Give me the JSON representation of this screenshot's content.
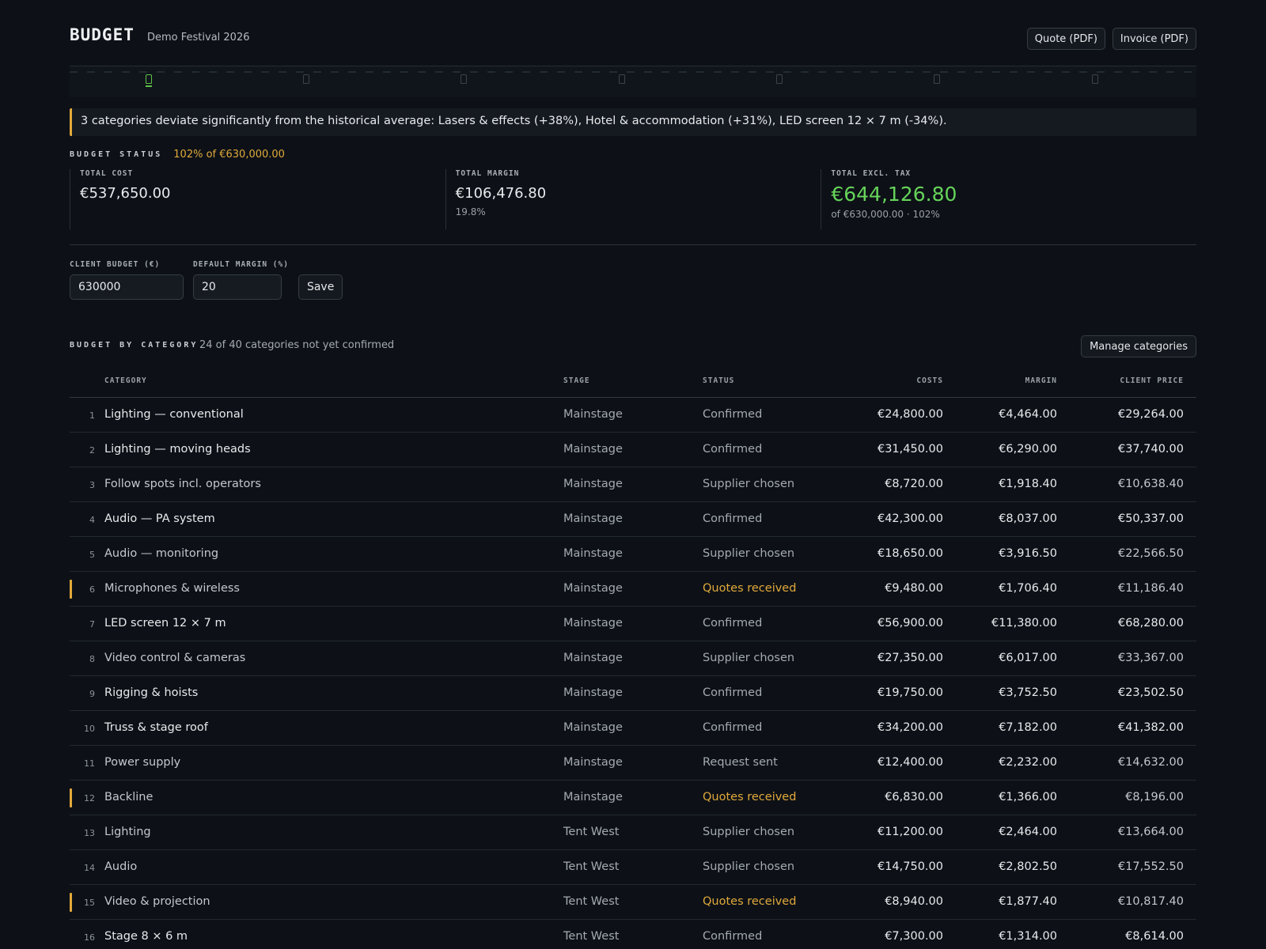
{
  "header": {
    "title": "BUDGET",
    "subtitle": "Demo Festival 2026",
    "quote_button": "Quote (PDF)",
    "invoice_button": "Invoice (PDF)"
  },
  "alert": {
    "text": "3 categories deviate significantly from the historical average: Lasers & effects (+38%), Hotel & accommodation (+31%), LED screen 12 × 7 m (-34%)."
  },
  "budget_status": {
    "label": "BUDGET STATUS",
    "summary": "102% of €630,000.00",
    "total_cost": {
      "label": "TOTAL COST",
      "value": "€537,650.00"
    },
    "total_margin": {
      "label": "TOTAL MARGIN",
      "value": "€106,476.80",
      "sub": "19.8%"
    },
    "total_excl_tax": {
      "label": "TOTAL EXCL. TAX",
      "value": "€644,126.80",
      "sub": "of €630,000.00 · 102%"
    }
  },
  "form": {
    "client_budget_label": "CLIENT BUDGET (€)",
    "client_budget_value": "630000",
    "default_margin_label": "DEFAULT MARGIN (%)",
    "default_margin_value": "20",
    "save_button": "Save"
  },
  "categories": {
    "title": "BUDGET BY CATEGORY",
    "note": "24 of 40 categories not yet confirmed",
    "manage_button": "Manage categories",
    "columns": {
      "category": "CATEGORY",
      "stage": "STAGE",
      "status": "STATUS",
      "costs": "COSTS",
      "margin": "MARGIN",
      "client_price": "CLIENT PRICE"
    },
    "rows": [
      {
        "num": "1",
        "category": "Lighting — conventional",
        "stage": "Mainstage",
        "status": "Confirmed",
        "costs": "€24,800.00",
        "margin": "€4,464.00",
        "price": "€29,264.00"
      },
      {
        "num": "2",
        "category": "Lighting — moving heads",
        "stage": "Mainstage",
        "status": "Confirmed",
        "costs": "€31,450.00",
        "margin": "€6,290.00",
        "price": "€37,740.00"
      },
      {
        "num": "3",
        "category": "Follow spots incl. operators",
        "stage": "Mainstage",
        "status": "Supplier chosen",
        "costs": "€8,720.00",
        "margin": "€1,918.40",
        "price": "€10,638.40"
      },
      {
        "num": "4",
        "category": "Audio — PA system",
        "stage": "Mainstage",
        "status": "Confirmed",
        "costs": "€42,300.00",
        "margin": "€8,037.00",
        "price": "€50,337.00"
      },
      {
        "num": "5",
        "category": "Audio — monitoring",
        "stage": "Mainstage",
        "status": "Supplier chosen",
        "costs": "€18,650.00",
        "margin": "€3,916.50",
        "price": "€22,566.50"
      },
      {
        "num": "6",
        "category": "Microphones & wireless",
        "stage": "Mainstage",
        "status": "Quotes received",
        "costs": "€9,480.00",
        "margin": "€1,706.40",
        "price": "€11,186.40"
      },
      {
        "num": "7",
        "category": "LED screen 12 × 7 m",
        "stage": "Mainstage",
        "status": "Confirmed",
        "costs": "€56,900.00",
        "margin": "€11,380.00",
        "price": "€68,280.00"
      },
      {
        "num": "8",
        "category": "Video control & cameras",
        "stage": "Mainstage",
        "status": "Supplier chosen",
        "costs": "€27,350.00",
        "margin": "€6,017.00",
        "price": "€33,367.00"
      },
      {
        "num": "9",
        "category": "Rigging & hoists",
        "stage": "Mainstage",
        "status": "Confirmed",
        "costs": "€19,750.00",
        "margin": "€3,752.50",
        "price": "€23,502.50"
      },
      {
        "num": "10",
        "category": "Truss & stage roof",
        "stage": "Mainstage",
        "status": "Confirmed",
        "costs": "€34,200.00",
        "margin": "€7,182.00",
        "price": "€41,382.00"
      },
      {
        "num": "11",
        "category": "Power supply",
        "stage": "Mainstage",
        "status": "Request sent",
        "costs": "€12,400.00",
        "margin": "€2,232.00",
        "price": "€14,632.00"
      },
      {
        "num": "12",
        "category": "Backline",
        "stage": "Mainstage",
        "status": "Quotes received",
        "costs": "€6,830.00",
        "margin": "€1,366.00",
        "price": "€8,196.00"
      },
      {
        "num": "13",
        "category": "Lighting",
        "stage": "Tent West",
        "status": "Supplier chosen",
        "costs": "€11,200.00",
        "margin": "€2,464.00",
        "price": "€13,664.00"
      },
      {
        "num": "14",
        "category": "Audio",
        "stage": "Tent West",
        "status": "Supplier chosen",
        "costs": "€14,750.00",
        "margin": "€2,802.50",
        "price": "€17,552.50"
      },
      {
        "num": "15",
        "category": "Video & projection",
        "stage": "Tent West",
        "status": "Quotes received",
        "costs": "€8,940.00",
        "margin": "€1,877.40",
        "price": "€10,817.40"
      },
      {
        "num": "16",
        "category": "Stage 8 × 6 m",
        "stage": "Tent West",
        "status": "Confirmed",
        "costs": "€7,300.00",
        "margin": "€1,314.00",
        "price": "€8,614.00"
      }
    ]
  },
  "colors": {
    "accent_amber": "#e1a93b",
    "accent_green": "#66d35a",
    "background": "#0d1117"
  }
}
